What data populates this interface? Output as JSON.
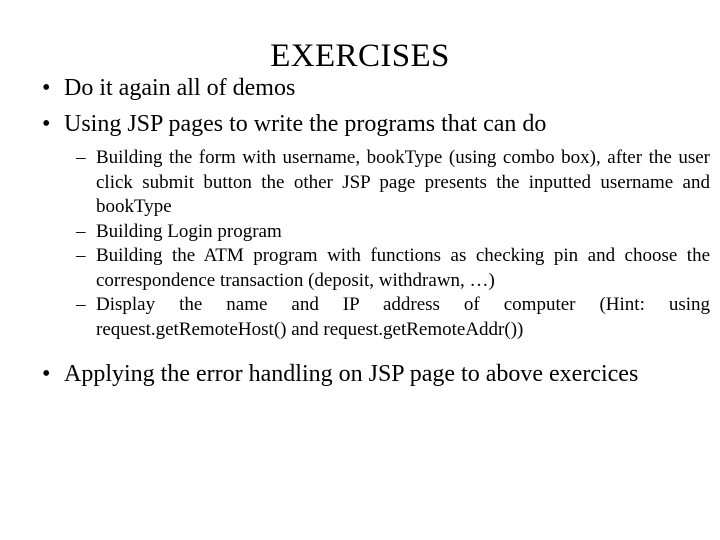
{
  "slide": {
    "title": "EXERCISES",
    "background_color": "#ffffff",
    "text_color": "#000000",
    "bullet_marker_level1": "•",
    "bullet_marker_level2": "–",
    "content": [
      {
        "level": 1,
        "text": "Do it again all of demos"
      },
      {
        "level": 1,
        "text": "Using JSP pages to write the programs that can do"
      },
      {
        "level": 2,
        "text": "Building the form with username, bookType (using combo box), after the user click submit button the other JSP page presents the inputted username and bookType"
      },
      {
        "level": 2,
        "text": "Building Login program"
      },
      {
        "level": 2,
        "text": "Building the ATM program with functions as checking pin and choose the correspondence transaction (deposit, withdrawn, …)"
      },
      {
        "level": 2,
        "text": "Display the name and IP address of computer (Hint: using request.getRemoteHost() and request.getRemoteAddr())"
      },
      {
        "level": 1,
        "text": "Applying the error handling on JSP page to above exercices"
      }
    ]
  }
}
